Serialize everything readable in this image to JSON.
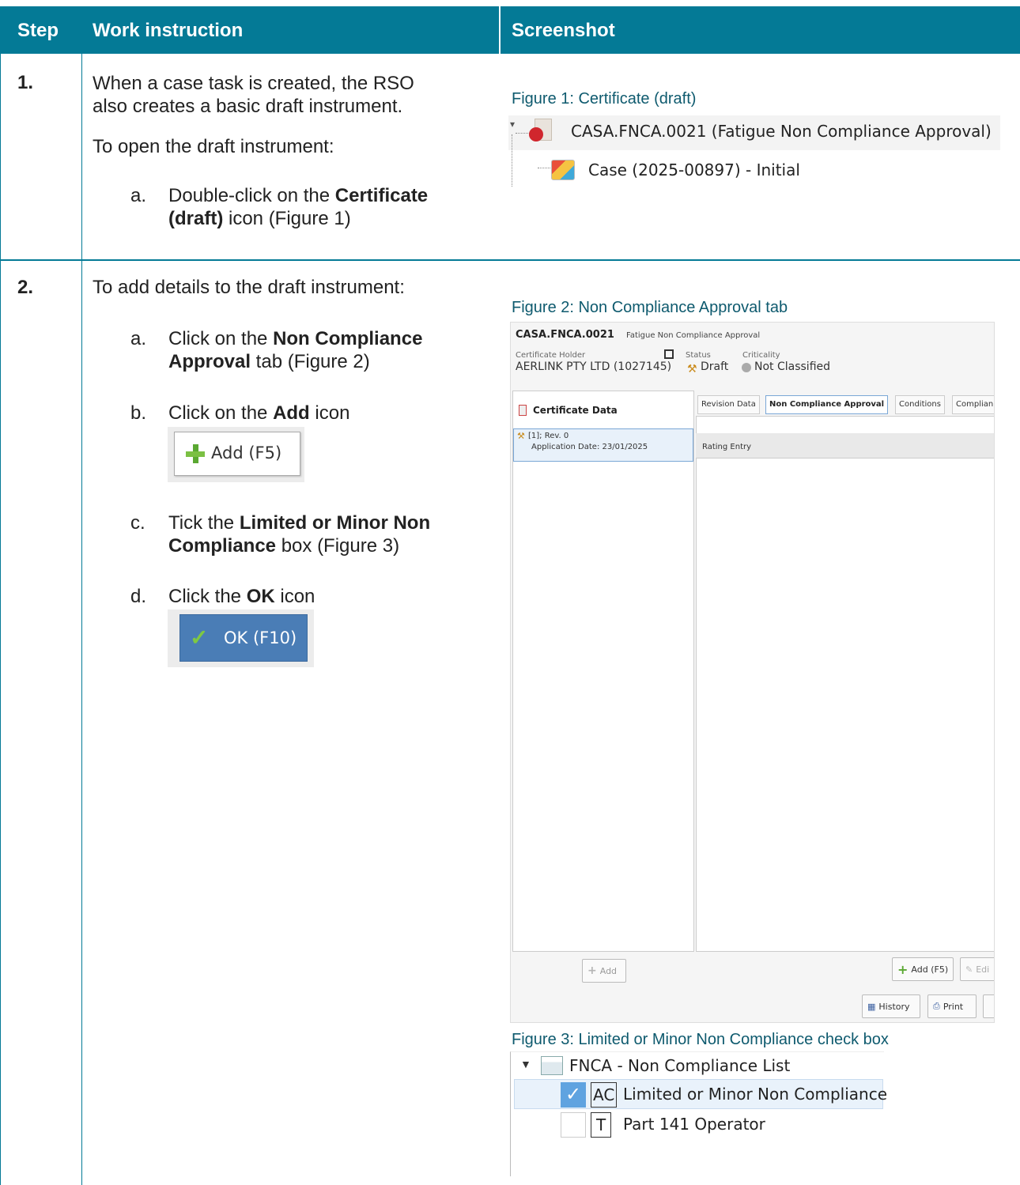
{
  "table": {
    "headers": {
      "step": "Step",
      "instruction": "Work instruction",
      "screenshot": "Screenshot"
    }
  },
  "step1": {
    "num": "1.",
    "line1": "When a case task is created, the RSO",
    "line2": "also creates a basic draft instrument.",
    "line3": "To open the draft instrument:",
    "a_letter": "a.",
    "a_pre": "Double-click on the ",
    "a_bold1": "Certificate",
    "a_bold2": "(draft)",
    "a_post": " icon (Figure 1)",
    "fig_caption": "Figure 1: Certificate (draft)",
    "tree_item1": "CASA.FNCA.0021 (Fatigue Non Compliance Approval)",
    "tree_item2": "Case (2025-00897)  - Initial"
  },
  "step2": {
    "num": "2.",
    "intro": "To add details to the draft instrument:",
    "a_letter": "a.",
    "a_pre": "Click on the ",
    "a_bold1": "Non Compliance",
    "a_bold2": "Approval",
    "a_post": " tab (Figure 2)",
    "b_letter": "b.",
    "b_pre": "Click on the ",
    "b_bold": "Add",
    "b_post": " icon",
    "add_btn": "Add (F5)",
    "c_letter": "c.",
    "c_pre": "Tick the ",
    "c_bold1": "Limited or Minor Non",
    "c_bold2": "Compliance",
    "c_post": " box (Figure 3)",
    "d_letter": "d.",
    "d_pre": "Click the ",
    "d_bold": "OK",
    "d_post": " icon",
    "ok_btn": "OK (F10)",
    "fig2_caption": "Figure 2: Non Compliance Approval tab",
    "fig3_caption": "Figure 3: Limited or Minor Non Compliance check box"
  },
  "fig2": {
    "cert_id": "CASA.FNCA.0021",
    "cert_type": "Fatigue Non Compliance Approval",
    "holder_label": "Certificate Holder",
    "holder_value": "AERLINK PTY LTD (1027145)",
    "status_label": "Status",
    "status_value": "Draft",
    "crit_label": "Criticality",
    "crit_value": "Not Classified",
    "left_title": "Certificate Data",
    "rev_line1": "[1]; Rev. 0",
    "rev_line2": "Application Date: 23/01/2025",
    "tabs": [
      "Revision Data",
      "Non Compliance Approval",
      "Conditions",
      "Complian"
    ],
    "grid_header": "Rating Entry",
    "left_add": "Add",
    "add_f5": "Add (F5)",
    "edit": "Edi",
    "history": "History",
    "print": "Print"
  },
  "fig3": {
    "list_title": "FNCA - Non Compliance List",
    "item1_code": "AC",
    "item1_label": "Limited or Minor Non Compliance",
    "item2_code": "T",
    "item2_label": "Part 141 Operator"
  }
}
